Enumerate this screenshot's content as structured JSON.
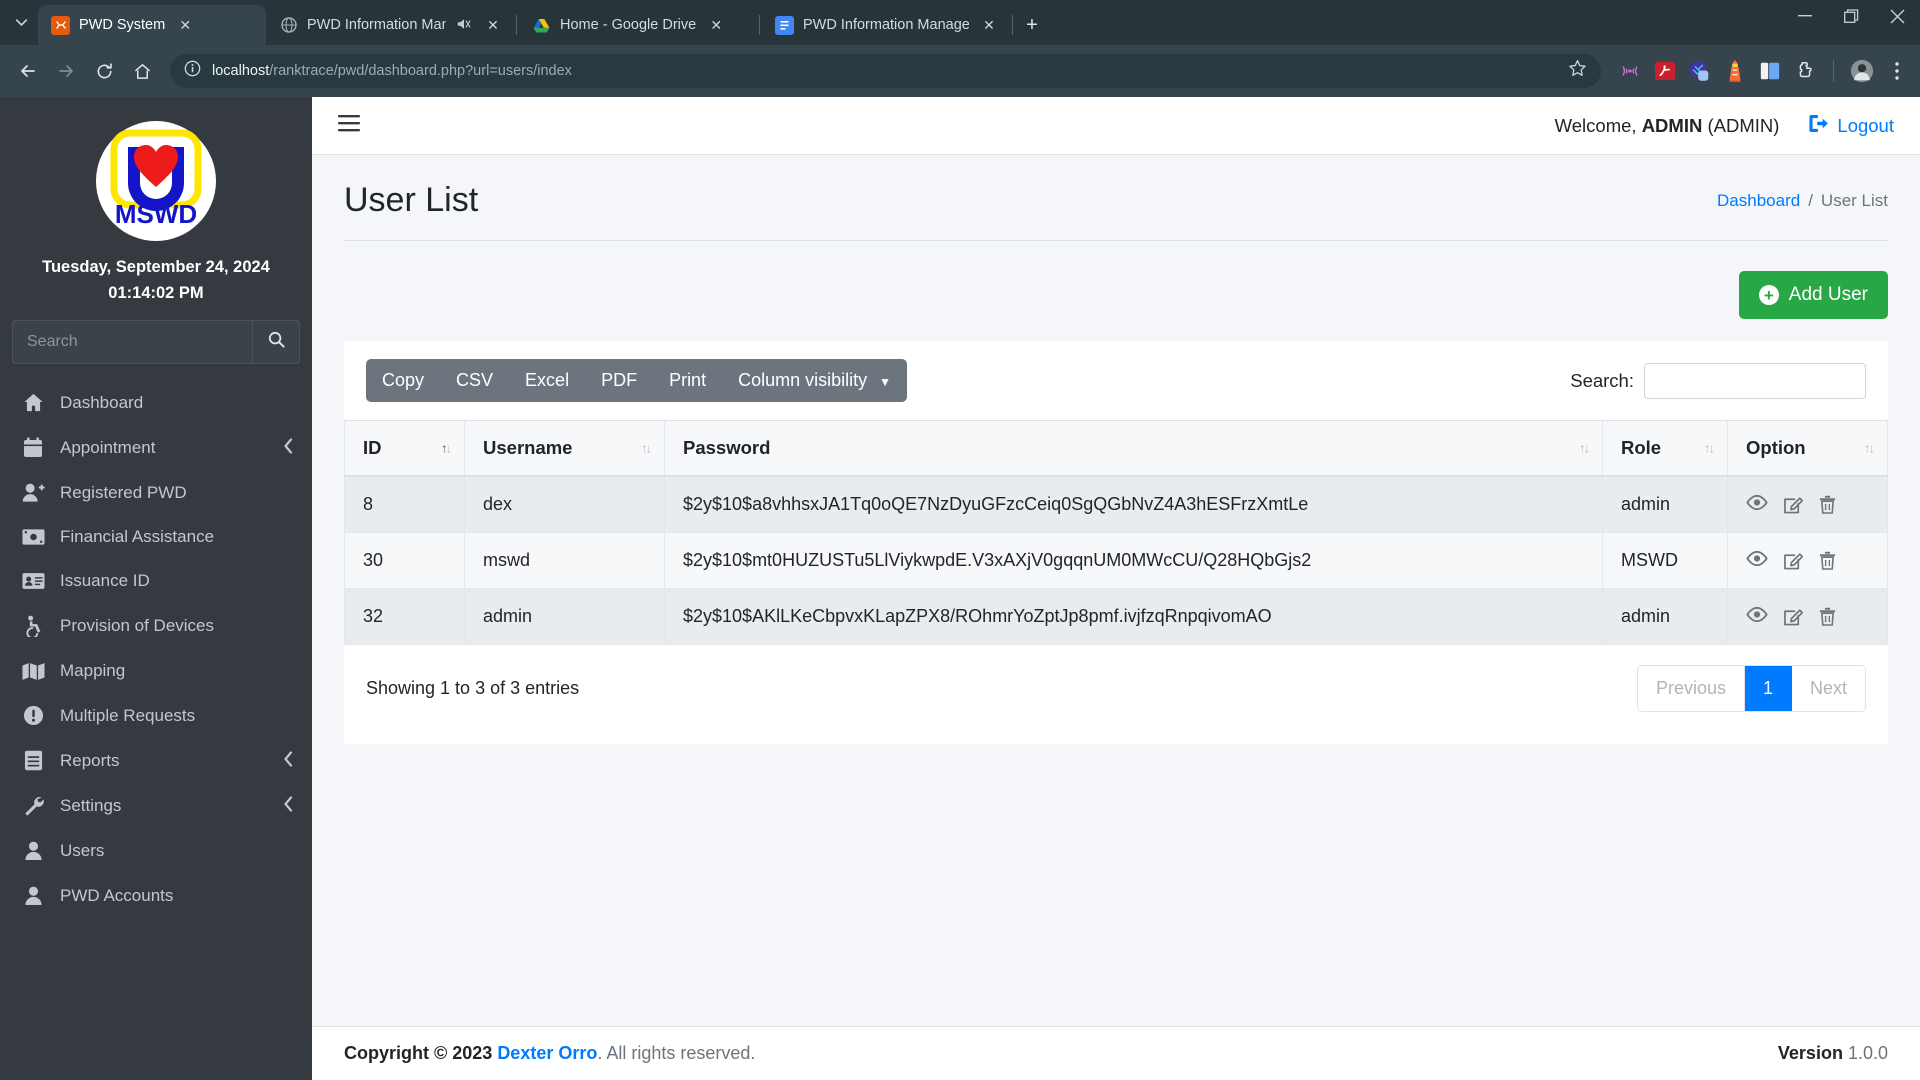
{
  "browser": {
    "tabs": [
      {
        "title": "PWD System",
        "favicon": "pwd-orange-icon",
        "active": true,
        "muted": false
      },
      {
        "title": "PWD Information Management",
        "favicon": "globe-icon",
        "active": false,
        "muted": true
      },
      {
        "title": "Home - Google Drive",
        "favicon": "google-drive-icon",
        "active": false,
        "muted": false
      },
      {
        "title": "PWD Information Management",
        "favicon": "google-docs-icon",
        "active": false,
        "muted": false
      }
    ],
    "newtab_label": "+",
    "window_controls": {
      "minimize": "—",
      "maximize": "❐",
      "close": "✕"
    },
    "nav": {
      "back": "←",
      "forward": "→",
      "reload": "↻",
      "home": "⌂"
    },
    "address": {
      "origin": "localhost",
      "path": "/ranktrace/pwd/dashboard.php?url=users/index",
      "info_icon": "site-info-icon",
      "star_icon": "bookmark-star-icon"
    },
    "extensions": [
      "cast-icon",
      "adobe-acrobat-icon",
      "grammarly-icon",
      "lighthouse-icon",
      "pocket-icon",
      "extensions-puzzle-icon",
      "profile-avatar-icon",
      "chrome-menu-icon"
    ]
  },
  "sidebar": {
    "logo_alt": "MSWD",
    "logo_text": "MSWD",
    "date": "Tuesday, September 24, 2024",
    "time": "01:14:02 PM",
    "search_placeholder": "Search",
    "search_value": "",
    "search_icon": "search-icon",
    "items": [
      {
        "label": "Dashboard",
        "icon": "home-icon",
        "caret": false
      },
      {
        "label": "Appointment",
        "icon": "calendar-icon",
        "caret": true
      },
      {
        "label": "Registered PWD",
        "icon": "user-plus-icon",
        "caret": false
      },
      {
        "label": "Financial Assistance",
        "icon": "money-bill-icon",
        "caret": false
      },
      {
        "label": "Issuance ID",
        "icon": "id-card-icon",
        "caret": false
      },
      {
        "label": "Provision of Devices",
        "icon": "wheelchair-icon",
        "caret": false
      },
      {
        "label": "Mapping",
        "icon": "map-icon",
        "caret": false
      },
      {
        "label": "Multiple Requests",
        "icon": "exclamation-circle-icon",
        "caret": false
      },
      {
        "label": "Reports",
        "icon": "file-lines-icon",
        "caret": true
      },
      {
        "label": "Settings",
        "icon": "wrench-icon",
        "caret": true
      },
      {
        "label": "Users",
        "icon": "user-icon",
        "caret": false
      },
      {
        "label": "PWD Accounts",
        "icon": "user-icon",
        "caret": false
      }
    ]
  },
  "topbar": {
    "menu_icon": "hamburger-icon",
    "welcome_prefix": "Welcome, ",
    "welcome_user": "ADMIN",
    "welcome_role": " (ADMIN)",
    "logout_label": "Logout",
    "logout_icon": "logout-icon"
  },
  "page": {
    "title": "User List",
    "breadcrumb_home": "Dashboard",
    "breadcrumb_sep": "/",
    "breadcrumb_current": "User List",
    "add_button": "Add User",
    "add_icon": "plus-circle-icon"
  },
  "datatable": {
    "buttons": [
      "Copy",
      "CSV",
      "Excel",
      "PDF",
      "Print"
    ],
    "column_visibility_label": "Column visibility",
    "search_label": "Search:",
    "search_value": "",
    "search_placeholder": "",
    "columns": [
      "ID",
      "Username",
      "Password",
      "Role",
      "Option"
    ],
    "rows": [
      {
        "id": "8",
        "username": "dex",
        "password": "$2y$10$a8vhhsxJA1Tq0oQE7NzDyuGFzcCeiq0SgQGbNvZ4A3hESFrzXmtLe",
        "role": "admin",
        "options": [
          "view-eye-icon",
          "edit-pen-icon",
          "delete-trash-icon"
        ]
      },
      {
        "id": "30",
        "username": "mswd",
        "password": "$2y$10$mt0HUZUSTu5LlViykwpdE.V3xAXjV0gqqnUM0MWcCU/Q28HQbGjs2",
        "role": "MSWD",
        "options": [
          "view-eye-icon",
          "edit-pen-icon",
          "delete-trash-icon"
        ]
      },
      {
        "id": "32",
        "username": "admin",
        "password": "$2y$10$AKlLKeCbpvxKLapZPX8/ROhmrYoZptJp8pmf.ivjfzqRnpqivomAO",
        "role": "admin",
        "options": [
          "view-eye-icon",
          "edit-pen-icon",
          "delete-trash-icon"
        ]
      }
    ],
    "info": "Showing 1 to 3 of 3 entries",
    "pagination": {
      "previous": "Previous",
      "pages": [
        "1"
      ],
      "next": "Next",
      "current": "1"
    }
  },
  "footer": {
    "copyright_prefix": "Copyright © 2023 ",
    "author": "Dexter Orro",
    "copyright_suffix": ". All rights reserved.",
    "version_label": "Version",
    "version_value": "1.0.0"
  },
  "colors": {
    "sidebar_bg": "#343a40",
    "accent_blue": "#007bff",
    "success_green": "#28a745",
    "dt_button_bg": "#6c757d",
    "chrome_bg": "#27353b"
  }
}
